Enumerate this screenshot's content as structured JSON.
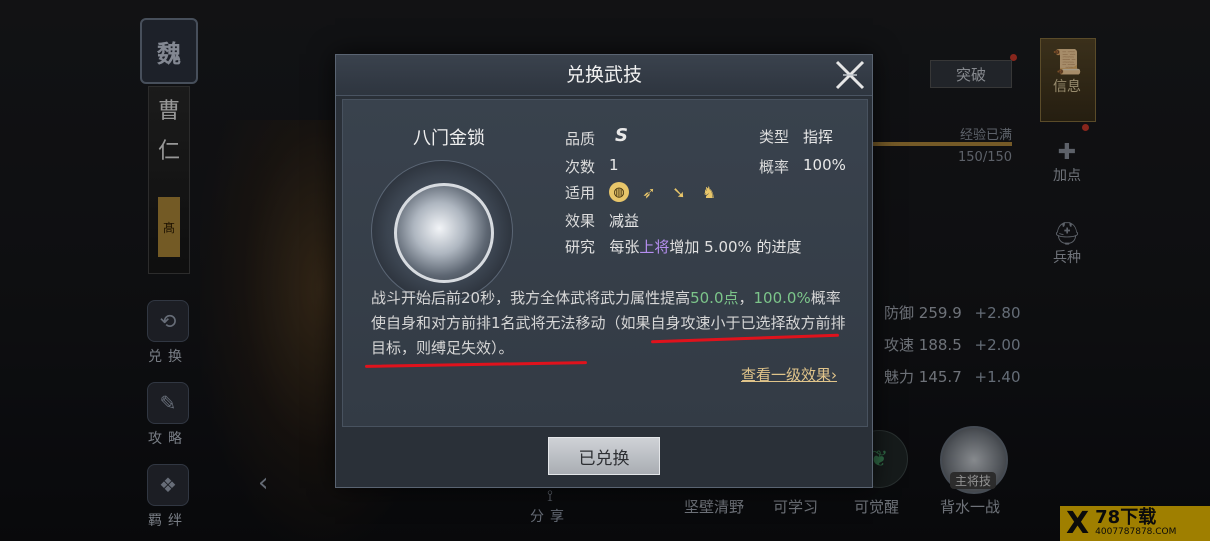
{
  "background": {
    "faction": "魏",
    "hero_name_chars": [
      "曹",
      "仁"
    ],
    "hero_tag": "髙",
    "left_menu": [
      {
        "label": "兑换",
        "icon": "swap-icon"
      },
      {
        "label": "攻略",
        "icon": "guide-icon"
      },
      {
        "label": "羁绊",
        "icon": "bond-icon"
      }
    ],
    "share_label": "分享",
    "breakout_label": "突破",
    "right_nav": [
      {
        "label": "信息",
        "icon": "scroll-icon"
      },
      {
        "label": "加点",
        "icon": "plus-point-icon"
      },
      {
        "label": "兵种",
        "icon": "helmet-icon"
      }
    ],
    "exp_full_label": "经验已满",
    "exp_value": "150/150",
    "stats": [
      {
        "name": "防御",
        "value": "259.9",
        "inc": "+2.80"
      },
      {
        "name": "攻速",
        "value": "188.5",
        "inc": "+2.00"
      },
      {
        "name": "魅力",
        "value": "145.7",
        "inc": "+1.40"
      }
    ],
    "bottom_skills": [
      "坚壁清野",
      "可学习",
      "可觉醒",
      "背水一战"
    ],
    "main_skill_tag": "主将技",
    "watermark_main": "78下载",
    "watermark_url": "4007787878.COM"
  },
  "modal": {
    "title": "兑换武技",
    "skill_name": "八门金锁",
    "quality_label": "品质",
    "quality_value": "S",
    "count_label": "次数",
    "count_value": "1",
    "apply_label": "适用",
    "apply_icons": [
      "shield-icon",
      "bow-icon",
      "spear-icon",
      "horse-icon"
    ],
    "effect_label": "效果",
    "effect_value": "减益",
    "research_label": "研究",
    "research_pre": "每张",
    "research_highlight": "上将",
    "research_post": "增加 5.00% 的进度",
    "type_label": "类型",
    "type_value": "指挥",
    "rate_label": "概率",
    "rate_value": "100%",
    "desc_part1": "战斗开始后前20秒，我方全体武将武力属性提高",
    "desc_num1": "50.0点",
    "desc_sep": "，",
    "desc_num2": "100.0%",
    "desc_part2": "概率使自身和对方前排1名武将无法移动（如果自身攻速小于已选择敌方前排目标，则缚足失效）。",
    "view_link": "查看一级效果",
    "redeemed_label": "已兑换"
  }
}
